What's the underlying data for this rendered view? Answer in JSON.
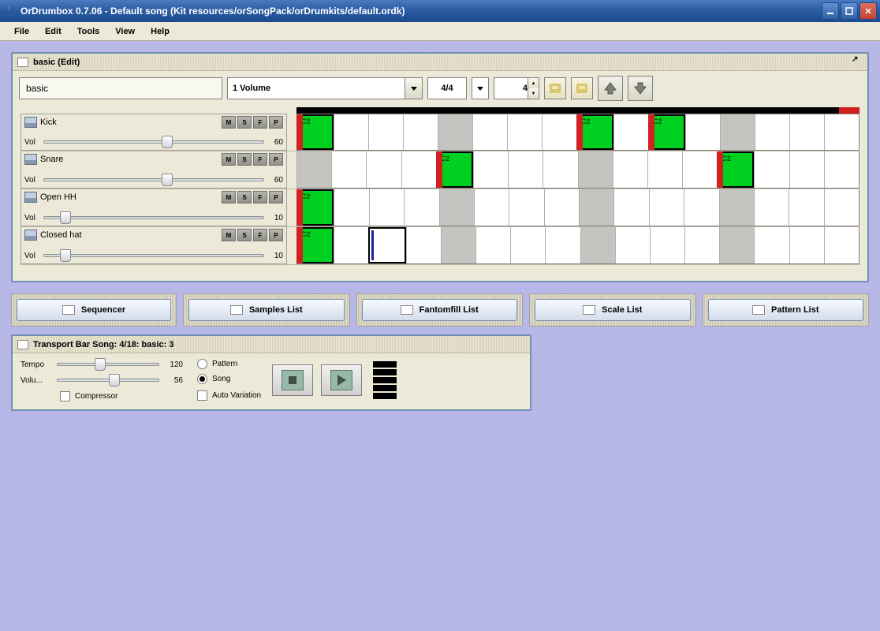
{
  "window": {
    "title": "OrDrumbox 0.7.06 - Default song (Kit resources/orSongPack/orDrumkits/default.ordk)"
  },
  "menu": {
    "items": [
      "File",
      "Edit",
      "Tools",
      "View",
      "Help"
    ]
  },
  "editor": {
    "panel_title": "basic (Edit)",
    "name": "basic",
    "param": "1 Volume",
    "time_sig": "4/4",
    "steps": "4"
  },
  "track_buttons": [
    "M",
    "S",
    "F",
    "P"
  ],
  "tracks": [
    {
      "name": "Kick",
      "vol": 60,
      "thumb": 56,
      "cells_c2": [
        0,
        8,
        10
      ],
      "beats": [
        0,
        4,
        8,
        12
      ],
      "marked": []
    },
    {
      "name": "Snare",
      "vol": 60,
      "thumb": 56,
      "cells_c2": [
        4,
        12
      ],
      "beats": [
        0,
        4,
        8,
        12
      ],
      "marked": []
    },
    {
      "name": "Open HH",
      "vol": 10,
      "thumb": 10,
      "cells_c2": [
        0
      ],
      "beats": [
        0,
        4,
        8,
        12
      ],
      "marked": []
    },
    {
      "name": "Closed hat",
      "vol": 10,
      "thumb": 10,
      "cells_c2": [
        0
      ],
      "beats": [
        0,
        4,
        8,
        12
      ],
      "marked": [
        2
      ]
    }
  ],
  "tabs": [
    "Sequencer",
    "Samples List",
    "Fantomfill List",
    "Scale List",
    "Pattern List"
  ],
  "transport": {
    "panel_title": "Transport Bar Song: 4/18: basic: 3",
    "tempo_label": "Tempo",
    "tempo": 120,
    "tempo_thumb": 42,
    "volume_label": "Volu...",
    "volume": 56,
    "volume_thumb": 56,
    "compressor_label": "Compressor",
    "pattern_label": "Pattern",
    "song_label": "Song",
    "autovar_label": "Auto Variation",
    "mode": "song"
  }
}
